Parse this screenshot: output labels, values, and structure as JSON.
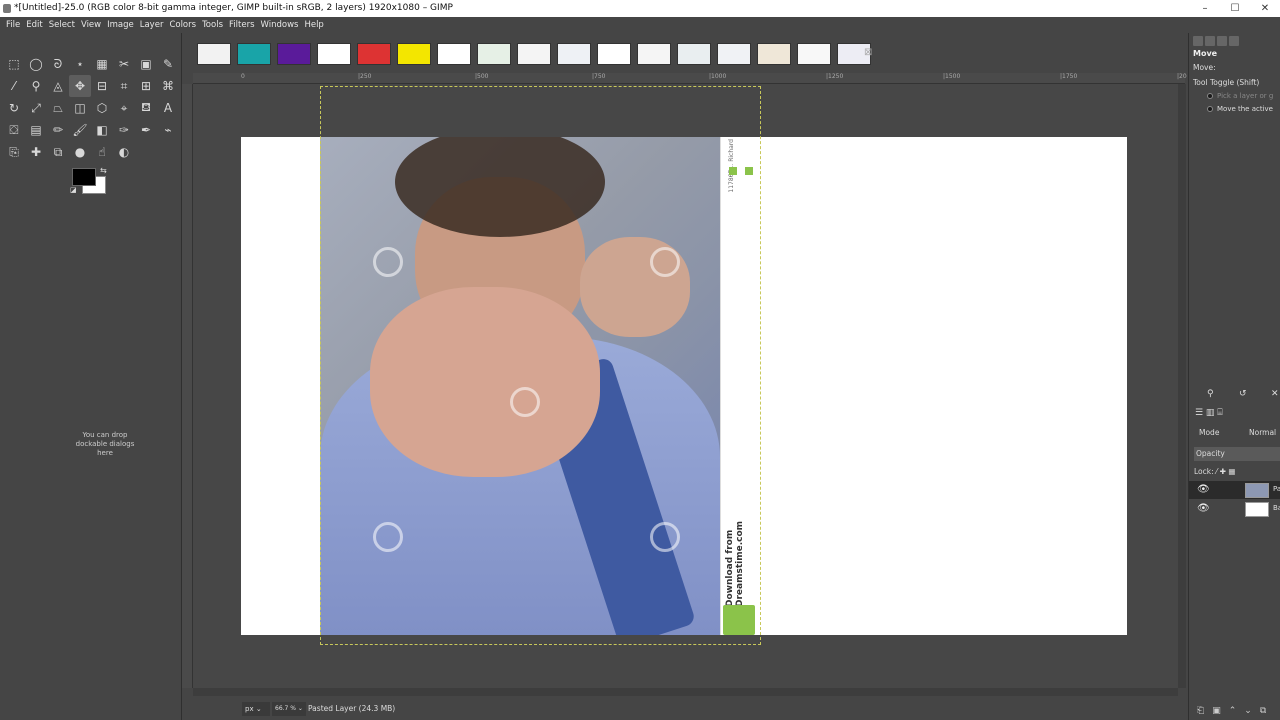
{
  "window": {
    "title": "*[Untitled]-25.0 (RGB color 8-bit gamma integer, GIMP built-in sRGB, 2 layers) 1920x1080 – GIMP",
    "min_label": "–",
    "max_label": "☐",
    "close_label": "✕"
  },
  "menu": [
    "File",
    "Edit",
    "Select",
    "View",
    "Image",
    "Layer",
    "Colors",
    "Tools",
    "Filters",
    "Windows",
    "Help"
  ],
  "toolbox": {
    "tools": [
      {
        "name": "rect-select-icon",
        "glyph": "⬚"
      },
      {
        "name": "ellipse-select-icon",
        "glyph": "◯"
      },
      {
        "name": "free-select-icon",
        "glyph": "ᘐ"
      },
      {
        "name": "fuzzy-select-icon",
        "glyph": "⋆"
      },
      {
        "name": "by-color-select-icon",
        "glyph": "▦"
      },
      {
        "name": "scissors-icon",
        "glyph": "✂"
      },
      {
        "name": "foreground-select-icon",
        "glyph": "▣"
      },
      {
        "name": "paths-icon",
        "glyph": "✎"
      },
      {
        "name": "color-picker-icon",
        "glyph": "⁄"
      },
      {
        "name": "zoom-icon",
        "glyph": "⚲"
      },
      {
        "name": "measure-icon",
        "glyph": "◬"
      },
      {
        "name": "move-icon",
        "glyph": "✥"
      },
      {
        "name": "align-icon",
        "glyph": "⊟"
      },
      {
        "name": "crop-icon",
        "glyph": "⌗"
      },
      {
        "name": "unified-transform-icon",
        "glyph": "⊞"
      },
      {
        "name": "warp-transform-icon",
        "glyph": "⌘"
      },
      {
        "name": "rotate-icon",
        "glyph": "↻"
      },
      {
        "name": "scale-icon",
        "glyph": "⤢"
      },
      {
        "name": "perspective-icon",
        "glyph": "⏢"
      },
      {
        "name": "flip-icon",
        "glyph": "◫"
      },
      {
        "name": "cage-icon",
        "glyph": "⬡"
      },
      {
        "name": "handle-transform-icon",
        "glyph": "⌖"
      },
      {
        "name": "bucket-fill-icon",
        "glyph": "⛾"
      },
      {
        "name": "text-icon",
        "glyph": "A"
      },
      {
        "name": "bucket-icon",
        "glyph": "⛋"
      },
      {
        "name": "gradient-icon",
        "glyph": "▤"
      },
      {
        "name": "pencil-icon",
        "glyph": "✏"
      },
      {
        "name": "paintbrush-icon",
        "glyph": "🖌"
      },
      {
        "name": "eraser-icon",
        "glyph": "◧"
      },
      {
        "name": "airbrush-icon",
        "glyph": "✑"
      },
      {
        "name": "ink-icon",
        "glyph": "✒"
      },
      {
        "name": "mypaint-brush-icon",
        "glyph": "⌁"
      },
      {
        "name": "clone-icon",
        "glyph": "⎘"
      },
      {
        "name": "heal-icon",
        "glyph": "✚"
      },
      {
        "name": "perspective-clone-icon",
        "glyph": "⧉"
      },
      {
        "name": "blur-icon",
        "glyph": "●"
      },
      {
        "name": "smudge-icon",
        "glyph": "☝"
      },
      {
        "name": "dodge-burn-icon",
        "glyph": "◐"
      }
    ],
    "dropzone_text": "You can drop dockable dialogs here"
  },
  "image_tabs": {
    "thumbnails": [
      {
        "name": "tab-thumb-1",
        "bg": "#f2f2f2"
      },
      {
        "name": "tab-thumb-2",
        "bg": "#19a4a8"
      },
      {
        "name": "tab-thumb-3",
        "bg": "#5a1b9a"
      },
      {
        "name": "tab-thumb-4",
        "bg": "#ffffff"
      },
      {
        "name": "tab-thumb-5",
        "bg": "#d33"
      },
      {
        "name": "tab-thumb-6",
        "bg": "#f3e600"
      },
      {
        "name": "tab-thumb-7",
        "bg": "#ffffff"
      },
      {
        "name": "tab-thumb-8",
        "bg": "#e6f0e6"
      },
      {
        "name": "tab-thumb-9",
        "bg": "#f4f4f4"
      },
      {
        "name": "tab-thumb-10",
        "bg": "#eef1f5"
      },
      {
        "name": "tab-thumb-11",
        "bg": "#ffffff"
      },
      {
        "name": "tab-thumb-12",
        "bg": "#f5f5f5"
      },
      {
        "name": "tab-thumb-13",
        "bg": "#e9eef0"
      },
      {
        "name": "tab-thumb-14",
        "bg": "#f0f2f5"
      },
      {
        "name": "tab-thumb-15",
        "bg": "#efe7d8"
      },
      {
        "name": "tab-thumb-16",
        "bg": "#f8f8f8"
      },
      {
        "name": "tab-thumb-17",
        "bg": "#ededf4"
      }
    ],
    "close": "⊠"
  },
  "ruler_top": [
    {
      "label": "0",
      "name": "ruler-mark-0"
    },
    {
      "label": "|250",
      "name": "ruler-mark-250"
    },
    {
      "label": "|500",
      "name": "ruler-mark-500"
    },
    {
      "label": "|750",
      "name": "ruler-mark-750"
    },
    {
      "label": "|1000",
      "name": "ruler-mark-1000"
    },
    {
      "label": "|1250",
      "name": "ruler-mark-1250"
    },
    {
      "label": "|1500",
      "name": "ruler-mark-1500"
    },
    {
      "label": "|1750",
      "name": "ruler-mark-1750"
    },
    {
      "label": "|20",
      "name": "ruler-mark-2000"
    }
  ],
  "canvas": {
    "watermark_text": "Download from\nDreamstime.com",
    "strip_id": "117867…  Richard",
    "layer_boundary_color": "#c8c85a"
  },
  "status": {
    "unit": "px",
    "zoom": "66.7 %",
    "message": "Pasted Layer (24.3 MB)"
  },
  "tool_options": {
    "title": "Move",
    "move_label": "Move:",
    "toggle_label": "Tool Toggle  (Shift)",
    "option1": "Pick a layer or g",
    "option2": "Move the active"
  },
  "layers": {
    "mode_label": "Mode",
    "mode_value": "Normal",
    "opacity_label": "Opacity",
    "lock_label": "Lock:",
    "items": [
      {
        "name": "Pa",
        "thumb": "#8d98b3"
      },
      {
        "name": "Ba",
        "thumb": "#ffffff"
      }
    ]
  }
}
